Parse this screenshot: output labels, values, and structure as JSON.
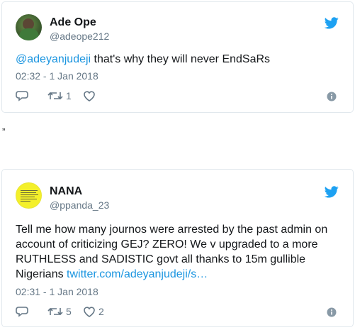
{
  "tweets": [
    {
      "display_name": "Ade Ope",
      "handle": "@adeope212",
      "text_mention": "@adeyanjudeji",
      "text_rest": " that's why they will never EndSaRs",
      "timestamp": "02:32 - 1 Jan 2018",
      "retweet_count": "1",
      "like_count": "",
      "avatar_icon": "avatar-photo",
      "accent_color": "#1da1f2"
    },
    {
      "display_name": "NANA",
      "handle": "@ppanda_23",
      "text_line1": "Tell me how many journos were arrested by the past admin on",
      "text_line2": "account of criticizing GEJ? ZERO! We v upgraded to a more",
      "text_line3": "RUTHLESS and SADISTIC govt all thanks to 15m gullible",
      "text_line4_prefix": "Nigerians ",
      "text_link": "twitter.com/adeyanjudeji/s…",
      "timestamp": "02:31 - 1 Jan 2018",
      "retweet_count": "5",
      "like_count": "2",
      "avatar_icon": "avatar-yellow",
      "accent_color": "#1da1f2"
    }
  ],
  "separator": "”"
}
